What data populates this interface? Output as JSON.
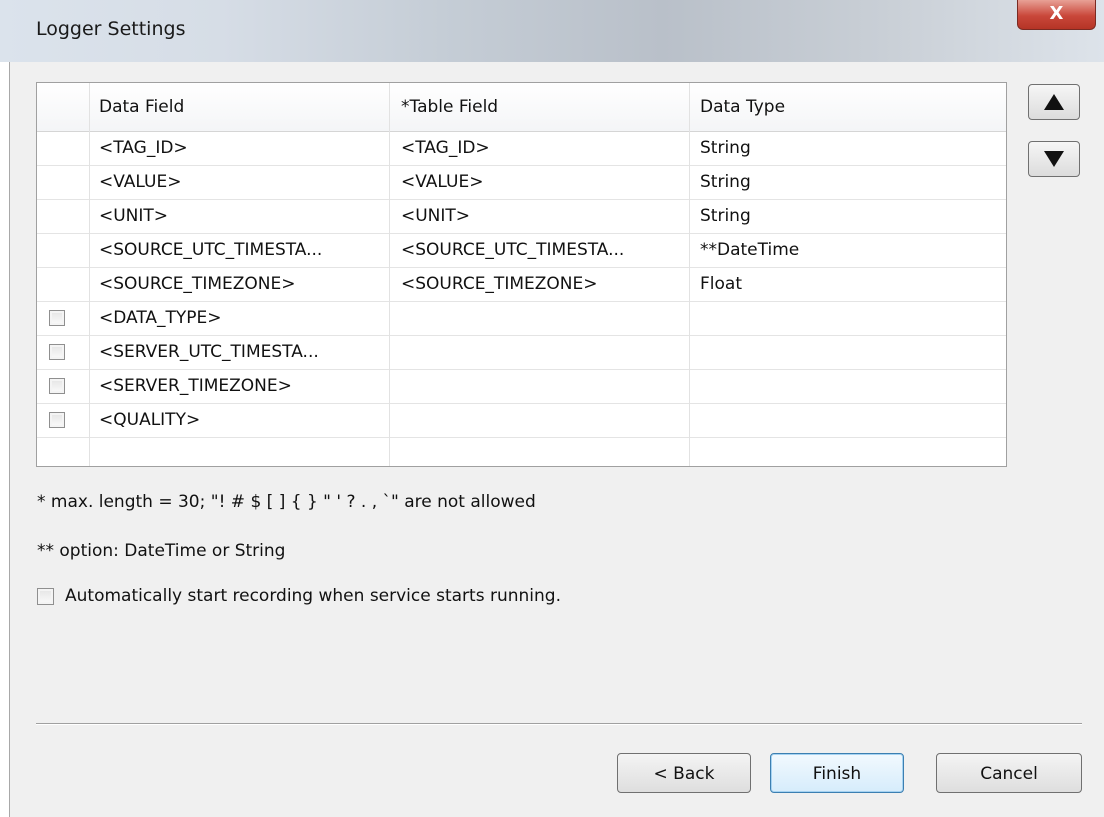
{
  "window": {
    "title": "Logger Settings",
    "close_glyph": "X"
  },
  "grid": {
    "columns": [
      "Data Field",
      "*Table Field",
      "Data Type"
    ],
    "rows": [
      {
        "checkbox": false,
        "data_field": "<TAG_ID>",
        "table_field": "<TAG_ID>",
        "data_type": "String"
      },
      {
        "checkbox": false,
        "data_field": "<VALUE>",
        "table_field": "<VALUE>",
        "data_type": "String"
      },
      {
        "checkbox": false,
        "data_field": "<UNIT>",
        "table_field": "<UNIT>",
        "data_type": "String"
      },
      {
        "checkbox": false,
        "data_field": "<SOURCE_UTC_TIMESTA...",
        "table_field": "<SOURCE_UTC_TIMESTA...",
        "data_type": "**DateTime"
      },
      {
        "checkbox": false,
        "data_field": "<SOURCE_TIMEZONE>",
        "table_field": "<SOURCE_TIMEZONE>",
        "data_type": "Float"
      },
      {
        "checkbox": true,
        "data_field": "<DATA_TYPE>",
        "table_field": "",
        "data_type": ""
      },
      {
        "checkbox": true,
        "data_field": "<SERVER_UTC_TIMESTA...",
        "table_field": "",
        "data_type": ""
      },
      {
        "checkbox": true,
        "data_field": "<SERVER_TIMEZONE>",
        "table_field": "",
        "data_type": ""
      },
      {
        "checkbox": true,
        "data_field": "<QUALITY>",
        "table_field": "",
        "data_type": ""
      }
    ]
  },
  "side_buttons": {
    "up_icon": "triangle-up-icon",
    "down_icon": "triangle-down-icon"
  },
  "notes": {
    "max_length": "* max. length = 30;  \"! # $ [ ] { } \" ' ? . , `\" are not allowed",
    "option": "**  option: DateTime or String"
  },
  "autostart": {
    "label": "Automatically start recording when service starts running.",
    "checked": false
  },
  "buttons": {
    "back": "< Back",
    "finish": "Finish",
    "cancel": "Cancel"
  }
}
